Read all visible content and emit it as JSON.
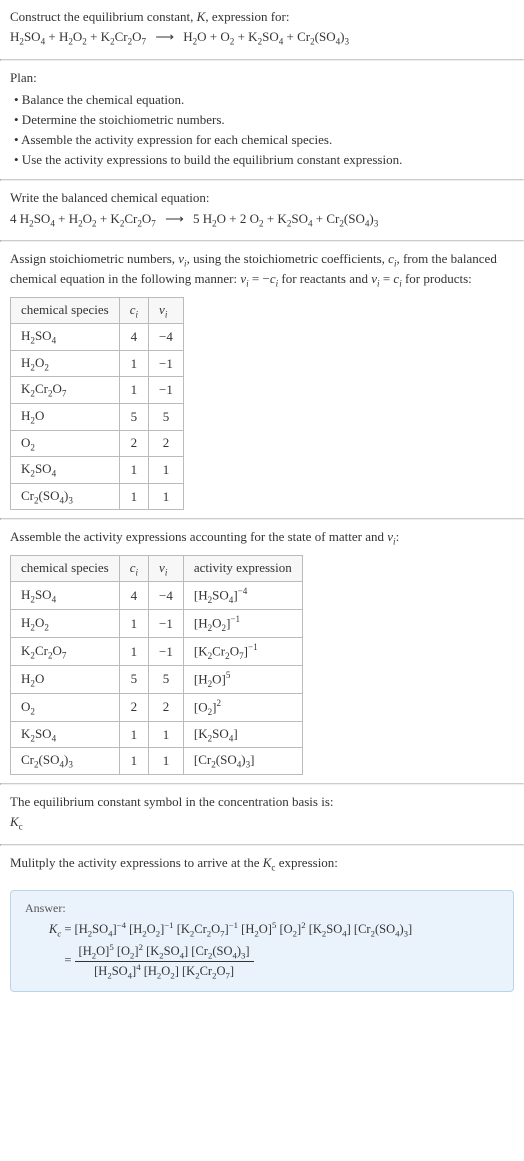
{
  "intro": {
    "line1": "Construct the equilibrium constant, ",
    "Kvar": "K",
    "line1b": ", expression for:"
  },
  "plan": {
    "heading": "Plan:",
    "b1": "• Balance the chemical equation.",
    "b2": "• Determine the stoichiometric numbers.",
    "b3": "• Assemble the activity expression for each chemical species.",
    "b4": "• Use the activity expressions to build the equilibrium constant expression."
  },
  "balanced": {
    "heading": "Write the balanced chemical equation:"
  },
  "stoich": {
    "text1": "Assign stoichiometric numbers, ",
    "nu": "ν",
    "text2": ", using the stoichiometric coefficients, ",
    "ci": "c",
    "text3": ", from the balanced chemical equation in the following manner: ",
    "rel1": " = −",
    "rel2": " for reactants and ",
    "rel3": " = ",
    "rel4": " for products:"
  },
  "table1": {
    "h1": "chemical species",
    "h2": "cᵢ",
    "h3": "νᵢ",
    "rows": [
      {
        "sp": "H₂SO₄",
        "c": "4",
        "v": "−4"
      },
      {
        "sp": "H₂O₂",
        "c": "1",
        "v": "−1"
      },
      {
        "sp": "K₂Cr₂O₇",
        "c": "1",
        "v": "−1"
      },
      {
        "sp": "H₂O",
        "c": "5",
        "v": "5"
      },
      {
        "sp": "O₂",
        "c": "2",
        "v": "2"
      },
      {
        "sp": "K₂SO₄",
        "c": "1",
        "v": "1"
      },
      {
        "sp": "Cr₂(SO₄)₃",
        "c": "1",
        "v": "1"
      }
    ]
  },
  "activity": {
    "heading": "Assemble the activity expressions accounting for the state of matter and νᵢ:"
  },
  "table2": {
    "h1": "chemical species",
    "h2": "cᵢ",
    "h3": "νᵢ",
    "h4": "activity expression",
    "rows": [
      {
        "sp": "H₂SO₄",
        "c": "4",
        "v": "−4",
        "a": "[H₂SO₄]⁻⁴"
      },
      {
        "sp": "H₂O₂",
        "c": "1",
        "v": "−1",
        "a": "[H₂O₂]⁻¹"
      },
      {
        "sp": "K₂Cr₂O₇",
        "c": "1",
        "v": "−1",
        "a": "[K₂Cr₂O₇]⁻¹"
      },
      {
        "sp": "H₂O",
        "c": "5",
        "v": "5",
        "a": "[H₂O]⁵"
      },
      {
        "sp": "O₂",
        "c": "2",
        "v": "2",
        "a": "[O₂]²"
      },
      {
        "sp": "K₂SO₄",
        "c": "1",
        "v": "1",
        "a": "[K₂SO₄]"
      },
      {
        "sp": "Cr₂(SO₄)₃",
        "c": "1",
        "v": "1",
        "a": "[Cr₂(SO₄)₃]"
      }
    ]
  },
  "kc": {
    "text": "The equilibrium constant symbol in the concentration basis is:",
    "sym": "K",
    "sub": "c"
  },
  "multiply": {
    "text": "Mulitply the activity expressions to arrive at the ",
    "sym": "K",
    "sub": "c",
    "text2": " expression:"
  },
  "answer": {
    "label": "Answer:",
    "lhs_sym": "K",
    "lhs_sub": "c",
    "eq": " = ",
    "prod": "[H₂SO₄]⁻⁴ [H₂O₂]⁻¹ [K₂Cr₂O₇]⁻¹ [H₂O]⁵ [O₂]² [K₂SO₄] [Cr₂(SO₄)₃]",
    "eq2": " = ",
    "num": "[H₂O]⁵ [O₂]² [K₂SO₄] [Cr₂(SO₄)₃]",
    "den": "[H₂SO₄]⁴ [H₂O₂] [K₂Cr₂O₇]"
  }
}
